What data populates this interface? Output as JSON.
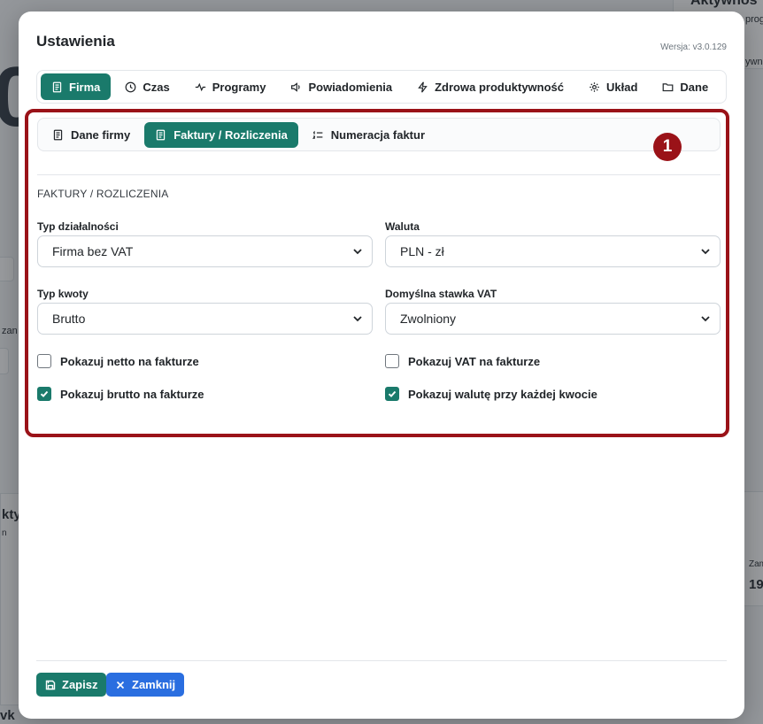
{
  "background": {
    "top_right_title": "Aktywnoś",
    "top_right_sub": "prog",
    "big_number": "0",
    "side_text_1": "kty",
    "side_text_2": "n",
    "right_label": "Zam",
    "right_value": "19",
    "bottom_left": "vk",
    "left_label": "zan",
    "right_small": "ywn"
  },
  "modal": {
    "title": "Ustawienia",
    "version": "Wersja: v3.0.129"
  },
  "main_tabs": [
    {
      "label": "Firma",
      "icon": "document-icon",
      "active": true
    },
    {
      "label": "Czas",
      "icon": "clock-icon",
      "active": false
    },
    {
      "label": "Programy",
      "icon": "activity-icon",
      "active": false
    },
    {
      "label": "Powiadomienia",
      "icon": "speaker-icon",
      "active": false
    },
    {
      "label": "Zdrowa produktywność",
      "icon": "lightning-icon",
      "active": false
    },
    {
      "label": "Układ",
      "icon": "gear-icon",
      "active": false
    },
    {
      "label": "Dane",
      "icon": "folder-icon",
      "active": false
    }
  ],
  "sub_tabs": [
    {
      "label": "Dane firmy",
      "icon": "document-icon",
      "active": false
    },
    {
      "label": "Faktury / Rozliczenia",
      "icon": "document-icon",
      "active": true
    },
    {
      "label": "Numeracja faktur",
      "icon": "list-numbers-icon",
      "active": false
    }
  ],
  "marker": "1",
  "section_title": "FAKTURY / ROZLICZENIA",
  "fields": {
    "typ_dzialalnosci": {
      "label": "Typ działalności",
      "value": "Firma bez VAT"
    },
    "waluta": {
      "label": "Waluta",
      "value": "PLN - zł"
    },
    "typ_kwoty": {
      "label": "Typ kwoty",
      "value": "Brutto"
    },
    "stawka_vat": {
      "label": "Domyślna stawka VAT",
      "value": "Zwolniony"
    }
  },
  "checkboxes": {
    "netto": {
      "label": "Pokazuj netto na fakturze",
      "checked": false
    },
    "vat": {
      "label": "Pokazuj VAT na fakturze",
      "checked": false
    },
    "brutto": {
      "label": "Pokazuj brutto na fakturze",
      "checked": true
    },
    "waluta": {
      "label": "Pokazuj walutę przy każdej kwocie",
      "checked": true
    }
  },
  "footer": {
    "save_label": "Zapisz",
    "close_label": "Zamknij"
  },
  "colors": {
    "accent": "#1a7a6b",
    "highlight": "#9a1218",
    "close_button": "#2a6ee0"
  }
}
